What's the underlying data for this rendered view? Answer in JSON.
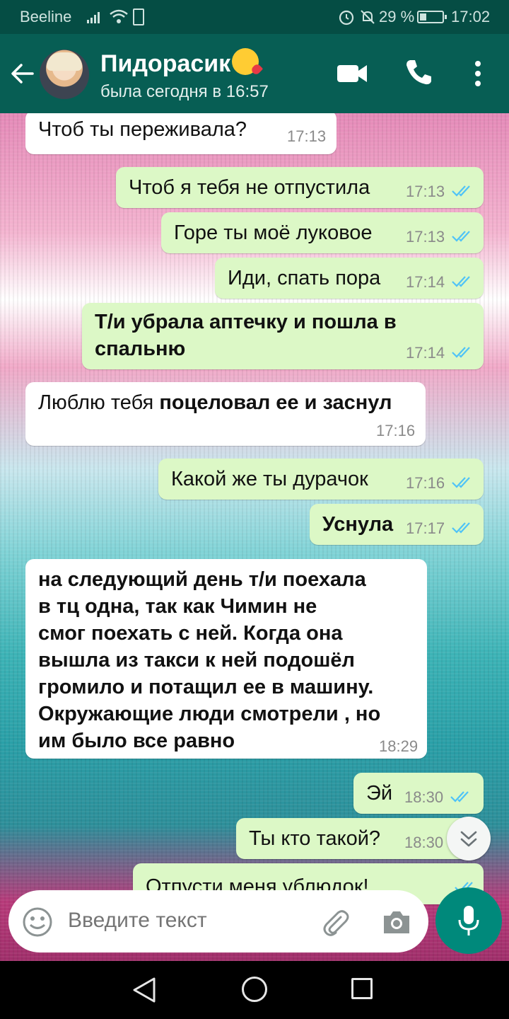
{
  "status_bar": {
    "carrier": "Beeline",
    "battery_percent": "29 %",
    "battery_level": 0.29,
    "time": "17:02"
  },
  "header": {
    "contact_name": "Пидорасик",
    "contact_emoji": "face-blowing-kiss",
    "last_seen": "была сегодня в 16:57",
    "icons": [
      "back-arrow-icon",
      "video-call-icon",
      "phone-call-icon",
      "more-vert-icon"
    ]
  },
  "messages": [
    {
      "dir": "in",
      "text": "Чтоб ты переживала?",
      "time": "17:13"
    },
    {
      "dir": "out",
      "text": "Чтоб я тебя не отпустила",
      "time": "17:13",
      "read": true
    },
    {
      "dir": "out",
      "text": "Горе ты моё луковое",
      "time": "17:13",
      "read": true
    },
    {
      "dir": "out",
      "text": "Иди, спать пора",
      "time": "17:14",
      "read": true
    },
    {
      "dir": "out",
      "text_line1": "Т/и убрала аптечку и пошла в",
      "text_line2": "спальню",
      "time": "17:14",
      "read": true,
      "bold": true
    },
    {
      "dir": "in",
      "text_plain": "Люблю тебя ",
      "text_bold": "поцеловал ее и заснул",
      "time": "17:16"
    },
    {
      "dir": "out",
      "text": "Какой же ты дурачок",
      "time": "17:16",
      "read": true
    },
    {
      "dir": "out",
      "text": "Уснула",
      "time": "17:17",
      "read": true,
      "bold": true
    },
    {
      "dir": "in",
      "lines": [
        "на следующий день т/и поехала",
        "в тц одна, так как Чимин не",
        "смог поехать с ней. Когда она",
        "вышла из такси к ней подошёл",
        "громило и потащил ее в машину.",
        "Окружающие люди смотрели , но",
        "им было все равно"
      ],
      "time": "18:29",
      "bold": true
    },
    {
      "dir": "out",
      "text": "Эй",
      "time": "18:30",
      "read": true
    },
    {
      "dir": "out",
      "text": "Ты кто такой?",
      "time": "18:30",
      "read": true
    },
    {
      "dir": "out",
      "text": "Отпусти меня ублюдок!",
      "time": "",
      "partial": true
    }
  ],
  "input": {
    "placeholder": "Введите текст"
  },
  "colors": {
    "header": "#075e54",
    "status_bar": "#054d44",
    "outgoing_bubble": "#dcf8c6",
    "incoming_bubble": "#ffffff",
    "read_ticks": "#4fc3f7",
    "fab": "#00897b"
  }
}
